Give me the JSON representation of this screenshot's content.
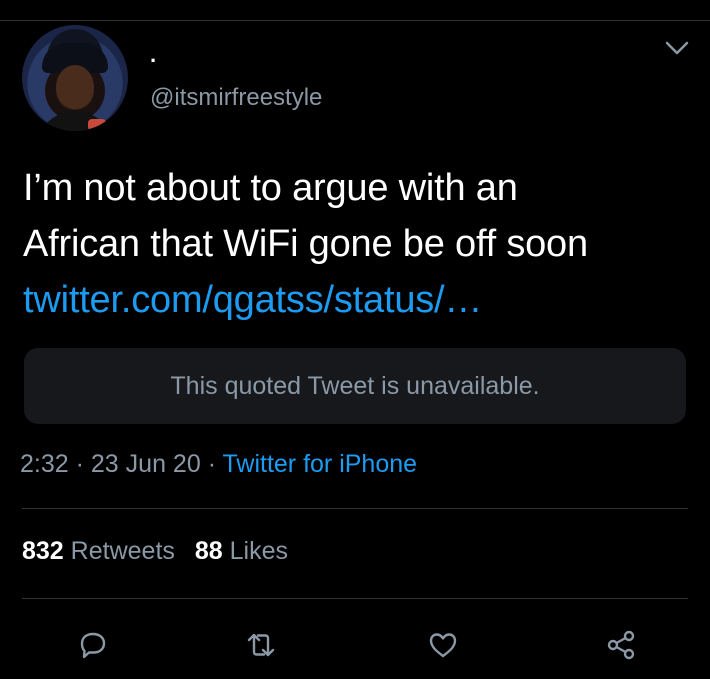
{
  "tweet": {
    "display_name": "·",
    "handle": "@itsmirfreestyle",
    "text_lines": [
      "I’m not about to argue with an",
      "African that WiFi gone be off soon"
    ],
    "link": "twitter.com/qgatss/status/…",
    "quoted_tweet": "This quoted Tweet is unavailable.",
    "time": "2:32",
    "separator_1": "·",
    "date": "23 Jun 20",
    "separator_2": "·",
    "source": "Twitter for iPhone"
  },
  "stats": {
    "retweets_count": "832",
    "retweets_label": "Retweets",
    "likes_count": "88",
    "likes_label": "Likes"
  },
  "actions": [
    "reply-icon",
    "retweet-icon",
    "like-icon",
    "share-icon"
  ],
  "colors": {
    "background": "#000000",
    "link": "#1d9bf0",
    "secondary_text": "#8b98a5",
    "divider": "#2f3336",
    "quote_box": "#16181c"
  }
}
